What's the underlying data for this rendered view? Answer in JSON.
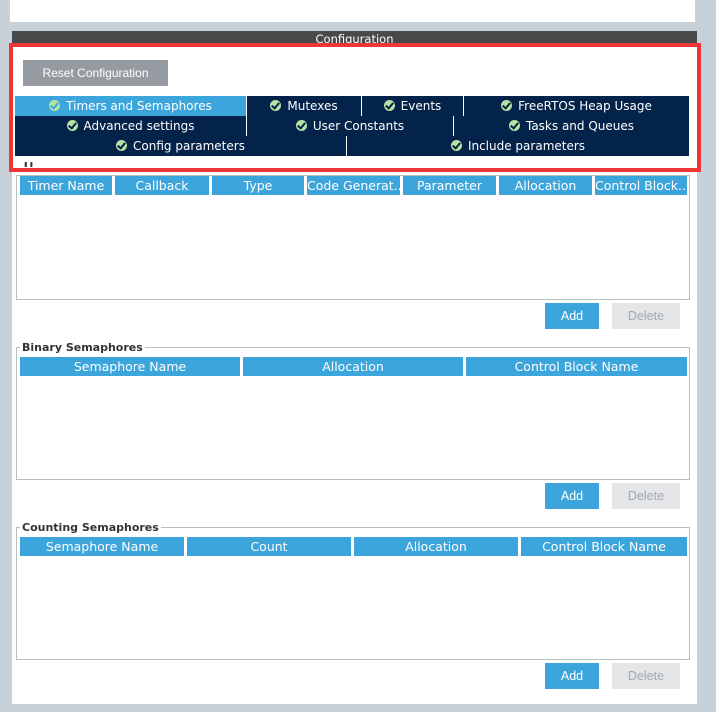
{
  "header": {
    "title": "Configuration"
  },
  "reset_label": "Reset Configuration",
  "tabs": {
    "timers": "Timers and Semaphores",
    "mutexes": "Mutexes",
    "events": "Events",
    "heap": "FreeRTOS Heap Usage",
    "advanced": "Advanced settings",
    "user_constants": "User Constants",
    "tasks": "Tasks and Queues",
    "config_params": "Config parameters",
    "include_params": "Include parameters"
  },
  "timers": {
    "title_fragment": "Ti",
    "columns": [
      "Timer Name",
      "Callback",
      "Type",
      "Code Generat...",
      "Parameter",
      "Allocation",
      "Control Block..."
    ],
    "add": "Add",
    "delete": "Delete"
  },
  "binary": {
    "title": "Binary Semaphores",
    "columns": [
      "Semaphore Name",
      "Allocation",
      "Control Block Name"
    ],
    "add": "Add",
    "delete": "Delete"
  },
  "counting": {
    "title": "Counting Semaphores",
    "columns": [
      "Semaphore Name",
      "Count",
      "Allocation",
      "Control Block Name"
    ],
    "add": "Add",
    "delete": "Delete"
  },
  "colors": {
    "accent": "#3ca5dc",
    "navy": "#03234b",
    "highlight": "#ee3538"
  }
}
